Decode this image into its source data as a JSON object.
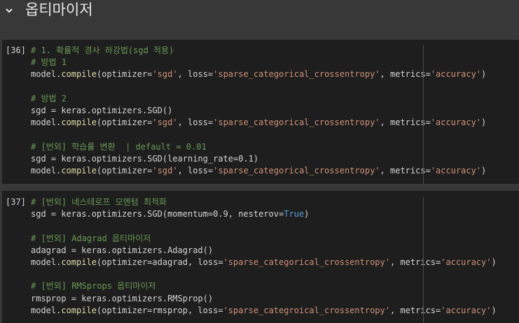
{
  "section": {
    "icon": "chevron-down-icon",
    "title": "옵티마이저"
  },
  "cells": [
    {
      "exec_count": "[36]",
      "lines": [
        [
          {
            "t": "# 1. 확률적 경사 하강법(sgd 적용)",
            "c": "c"
          }
        ],
        [
          {
            "t": "# 방법 1",
            "c": "c"
          }
        ],
        [
          {
            "t": "model."
          },
          {
            "t": "compile",
            "c": "f"
          },
          {
            "t": "(optimizer="
          },
          {
            "t": "'sgd'",
            "c": "s"
          },
          {
            "t": ", loss="
          },
          {
            "t": "'sparse_categorical_crossentropy'",
            "c": "s"
          },
          {
            "t": ", metrics="
          },
          {
            "t": "'accuracy'",
            "c": "s"
          },
          {
            "t": ")"
          }
        ],
        [],
        [
          {
            "t": "# 방법 2",
            "c": "c"
          }
        ],
        [
          {
            "t": "sgd = keras.optimizers.SGD()"
          }
        ],
        [
          {
            "t": "model."
          },
          {
            "t": "compile",
            "c": "f"
          },
          {
            "t": "(optimizer="
          },
          {
            "t": "'sgd'",
            "c": "s"
          },
          {
            "t": ", loss="
          },
          {
            "t": "'sparse_categorical_crossentropy'",
            "c": "s"
          },
          {
            "t": ", metrics="
          },
          {
            "t": "'accuracy'",
            "c": "s"
          },
          {
            "t": ")"
          }
        ],
        [],
        [
          {
            "t": "# [번외] 학습률 변환  | default = 0.01",
            "c": "c"
          }
        ],
        [
          {
            "t": "sgd = keras.optimizers.SGD(learning_rate=0.1)"
          }
        ],
        [
          {
            "t": "model."
          },
          {
            "t": "compile",
            "c": "f"
          },
          {
            "t": "(optimizer="
          },
          {
            "t": "'sgd'",
            "c": "s"
          },
          {
            "t": ", loss="
          },
          {
            "t": "'sparse_categorical_crossentropy'",
            "c": "s"
          },
          {
            "t": ", metrics="
          },
          {
            "t": "'accuracy'",
            "c": "s"
          },
          {
            "t": ")"
          }
        ]
      ]
    },
    {
      "exec_count": "[37]",
      "lines": [
        [
          {
            "t": "# [번외] 네스테로프 모멘텀 최적화",
            "c": "c"
          }
        ],
        [
          {
            "t": "sgd = keras.optimizers.SGD(momentum=0.9, nesterov="
          },
          {
            "t": "True",
            "c": "k"
          },
          {
            "t": ")"
          }
        ],
        [],
        [
          {
            "t": "# [번외] Adagrad 옵티마이저",
            "c": "c"
          }
        ],
        [
          {
            "t": "adagrad = keras.optimizers.Adagrad()"
          }
        ],
        [
          {
            "t": "model."
          },
          {
            "t": "compile",
            "c": "f"
          },
          {
            "t": "(optimizer=adagrad, loss="
          },
          {
            "t": "'sparse_categorical_crossentropy'",
            "c": "s"
          },
          {
            "t": ", metrics="
          },
          {
            "t": "'accuracy'",
            "c": "s"
          },
          {
            "t": ")"
          }
        ],
        [],
        [
          {
            "t": "# [번외] RMSprops 옵티마이저",
            "c": "c"
          }
        ],
        [
          {
            "t": "rmsprop = keras.optimizers.RMSprop()"
          }
        ],
        [
          {
            "t": "model."
          },
          {
            "t": "compile",
            "c": "f"
          },
          {
            "t": "(optimizer=rmsprop, loss="
          },
          {
            "t": "'sparse_categroical_crossentropy'",
            "c": "s"
          },
          {
            "t": ", metrics="
          },
          {
            "t": "'accuracy'",
            "c": "s"
          },
          {
            "t": ")"
          }
        ]
      ]
    }
  ]
}
